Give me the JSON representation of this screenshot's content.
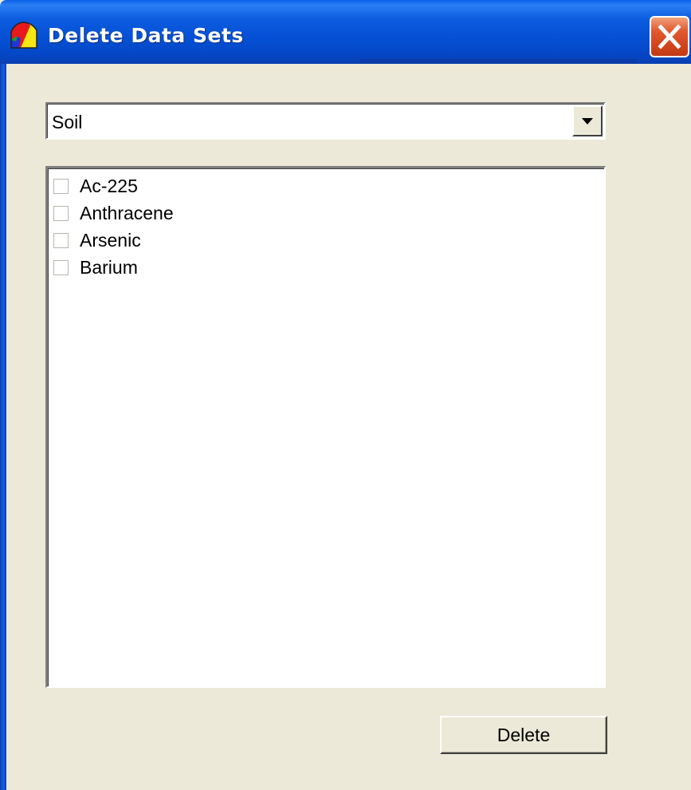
{
  "window": {
    "title": "Delete Data Sets",
    "titlebar_color": "#0550d4",
    "close_button_color": "#d2451d",
    "body_color": "#ece9d8"
  },
  "dataset_type": {
    "selected": "Soil"
  },
  "datasets": [
    {
      "label": "Ac-225",
      "checked": false
    },
    {
      "label": "Anthracene",
      "checked": false
    },
    {
      "label": "Arsenic",
      "checked": false
    },
    {
      "label": "Barium",
      "checked": false
    }
  ],
  "actions": {
    "delete_label": "Delete"
  },
  "icons": {
    "app": "app-logo-icon",
    "close": "close-icon",
    "dropdown": "dropdown-arrow-icon"
  }
}
